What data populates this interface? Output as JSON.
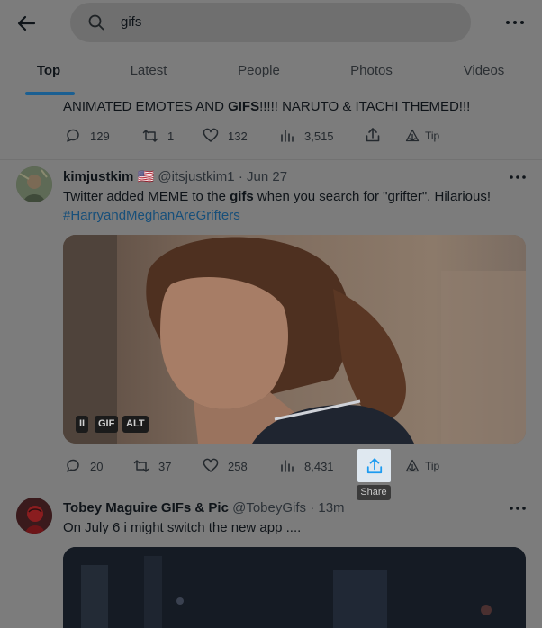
{
  "search": {
    "value": "gifs"
  },
  "tabs": [
    "Top",
    "Latest",
    "People",
    "Photos",
    "Videos"
  ],
  "tweet0": {
    "text_pre": "ANIMATED EMOTES AND ",
    "text_bold": "GIFS",
    "text_post": "!!!!! NARUTO & ITACHI THEMED!!!",
    "replies": "129",
    "retweets": "1",
    "likes": "132",
    "views": "3,515",
    "tip": "Tip"
  },
  "tweet1": {
    "name": "kimjustkim",
    "flag": "🇺🇸",
    "handle": "@itsjustkim1",
    "sep": "·",
    "date": "Jun 27",
    "text_pre": "Twitter added MEME to the ",
    "text_bold": "gifs",
    "text_post": " when you search for \"grifter\".  Hilarious!",
    "hashtag": "#HarryandMeghanAreGrifters",
    "badges": {
      "pause": "II",
      "gif": "GIF",
      "alt": "ALT"
    },
    "replies": "20",
    "retweets": "37",
    "likes": "258",
    "views": "8,431",
    "tip": "Tip",
    "share_tooltip": "Share"
  },
  "tweet2": {
    "name": "Tobey Maguire GIFs & Pic",
    "handle": "@TobeyGifs",
    "sep": "·",
    "date": "13m",
    "text": "On July 6 i might switch the new app ...."
  },
  "colors": {
    "accent": "#1d9bf0",
    "overlay": "#7c7c7c"
  }
}
